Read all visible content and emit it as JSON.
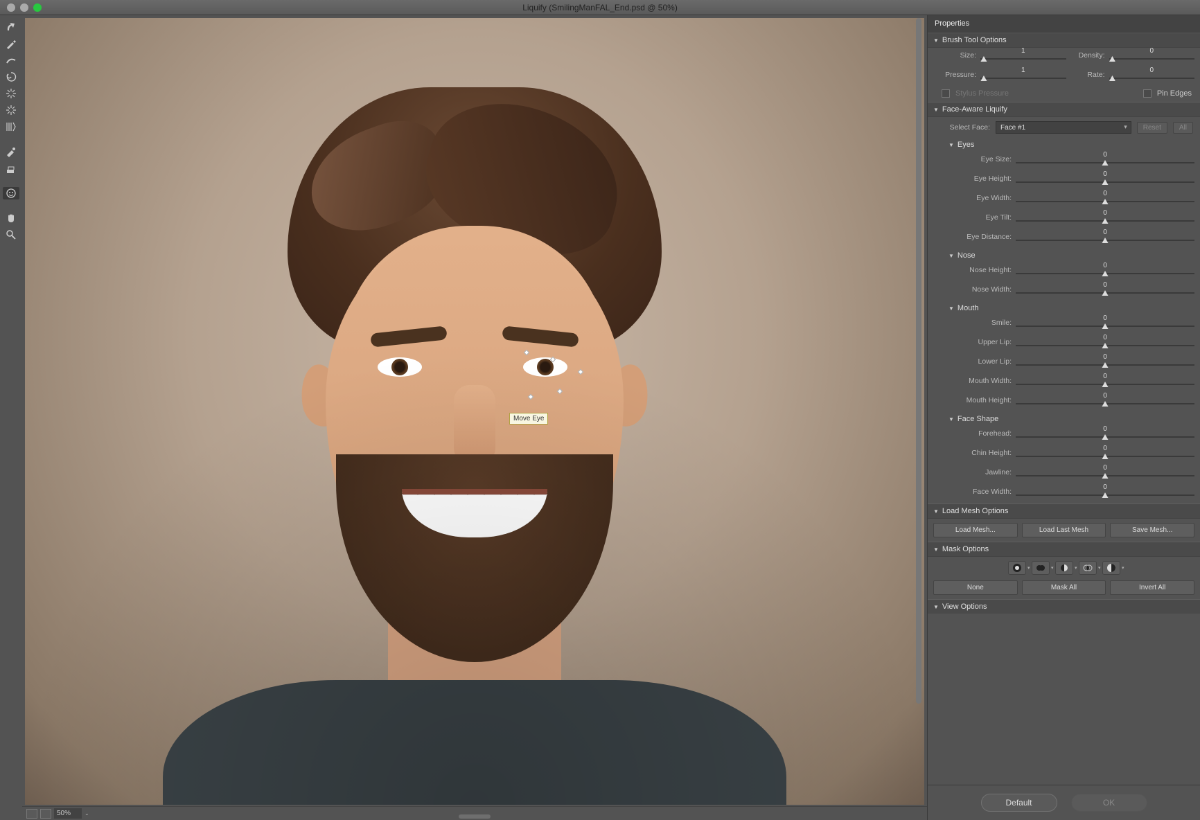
{
  "window": {
    "title": "Liquify (SmilingManFAL_End.psd @ 50%)"
  },
  "tooltip": "Move Eye",
  "statusbar": {
    "zoom": "50%"
  },
  "panel": {
    "title": "Properties",
    "brush": {
      "header": "Brush Tool Options",
      "size_label": "Size:",
      "size_val": "1",
      "density_label": "Density:",
      "density_val": "0",
      "pressure_label": "Pressure:",
      "pressure_val": "1",
      "rate_label": "Rate:",
      "rate_val": "0",
      "stylus": "Stylus Pressure",
      "pin": "Pin Edges"
    },
    "face": {
      "header": "Face-Aware Liquify",
      "select_label": "Select Face:",
      "select_val": "Face #1",
      "reset": "Reset",
      "all": "All",
      "eyes": {
        "header": "Eyes",
        "size": "Eye Size:",
        "size_v": "0",
        "height": "Eye Height:",
        "height_v": "0",
        "width": "Eye Width:",
        "width_v": "0",
        "tilt": "Eye Tilt:",
        "tilt_v": "0",
        "dist": "Eye Distance:",
        "dist_v": "0"
      },
      "nose": {
        "header": "Nose",
        "height": "Nose Height:",
        "height_v": "0",
        "width": "Nose Width:",
        "width_v": "0"
      },
      "mouth": {
        "header": "Mouth",
        "smile": "Smile:",
        "smile_v": "0",
        "upper": "Upper Lip:",
        "upper_v": "0",
        "lower": "Lower Lip:",
        "lower_v": "0",
        "width": "Mouth Width:",
        "width_v": "0",
        "height": "Mouth Height:",
        "height_v": "0"
      },
      "shape": {
        "header": "Face Shape",
        "forehead": "Forehead:",
        "forehead_v": "0",
        "chin": "Chin Height:",
        "chin_v": "0",
        "jaw": "Jawline:",
        "jaw_v": "0",
        "width": "Face Width:",
        "width_v": "0"
      }
    },
    "mesh": {
      "header": "Load Mesh Options",
      "load": "Load Mesh...",
      "last": "Load Last Mesh",
      "save": "Save Mesh..."
    },
    "mask": {
      "header": "Mask Options",
      "none": "None",
      "all": "Mask All",
      "invert": "Invert All"
    },
    "view": {
      "header": "View Options"
    }
  },
  "footer": {
    "default": "Default",
    "ok": "OK"
  }
}
